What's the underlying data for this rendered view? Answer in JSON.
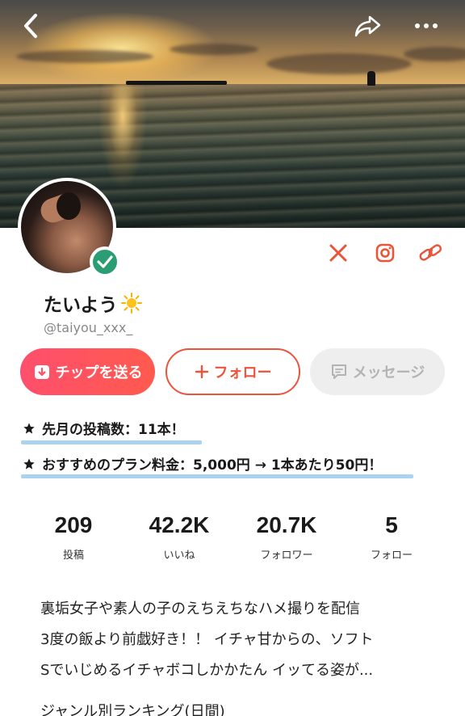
{
  "header": {
    "back_icon": "chevron-left-icon",
    "share_icon": "share-icon",
    "more_icon": "more-horizontal-icon"
  },
  "profile": {
    "display_name": "たいよう",
    "name_emoji": "sun-icon",
    "handle": "@taiyou_xxx_",
    "verified": true,
    "verified_color": "#2a9d74"
  },
  "social_links": [
    {
      "name": "x-icon"
    },
    {
      "name": "instagram-icon"
    },
    {
      "name": "link-icon"
    }
  ],
  "actions": {
    "tip_label": "チップを送る",
    "follow_label": "フォロー",
    "message_label": "メッセージ"
  },
  "promos": [
    {
      "text": "先月の投稿数：11本！"
    },
    {
      "text": "おすすめのプラン料金：5,000円 → 1本あたり50円！"
    }
  ],
  "stats": [
    {
      "value": "209",
      "label": "投稿"
    },
    {
      "value": "42.2K",
      "label": "いいね"
    },
    {
      "value": "20.7K",
      "label": "フォロワー"
    },
    {
      "value": "5",
      "label": "フォロー"
    }
  ],
  "bio": {
    "lines": [
      "裏垢女子や素人の子のえちえちなハメ撮りを配信",
      "3度の飯より前戯好き！！ イチャ甘からの、ソフト",
      "Sでいじめるイチャボコしかかたん イッてる姿が..."
    ]
  },
  "genre_ranking_label": "ジャンル別ランキング(日間)",
  "colors": {
    "accent": "#e8553b",
    "tip_gradient_start": "#ff4f6d",
    "highlight": "#a9d3f0"
  }
}
